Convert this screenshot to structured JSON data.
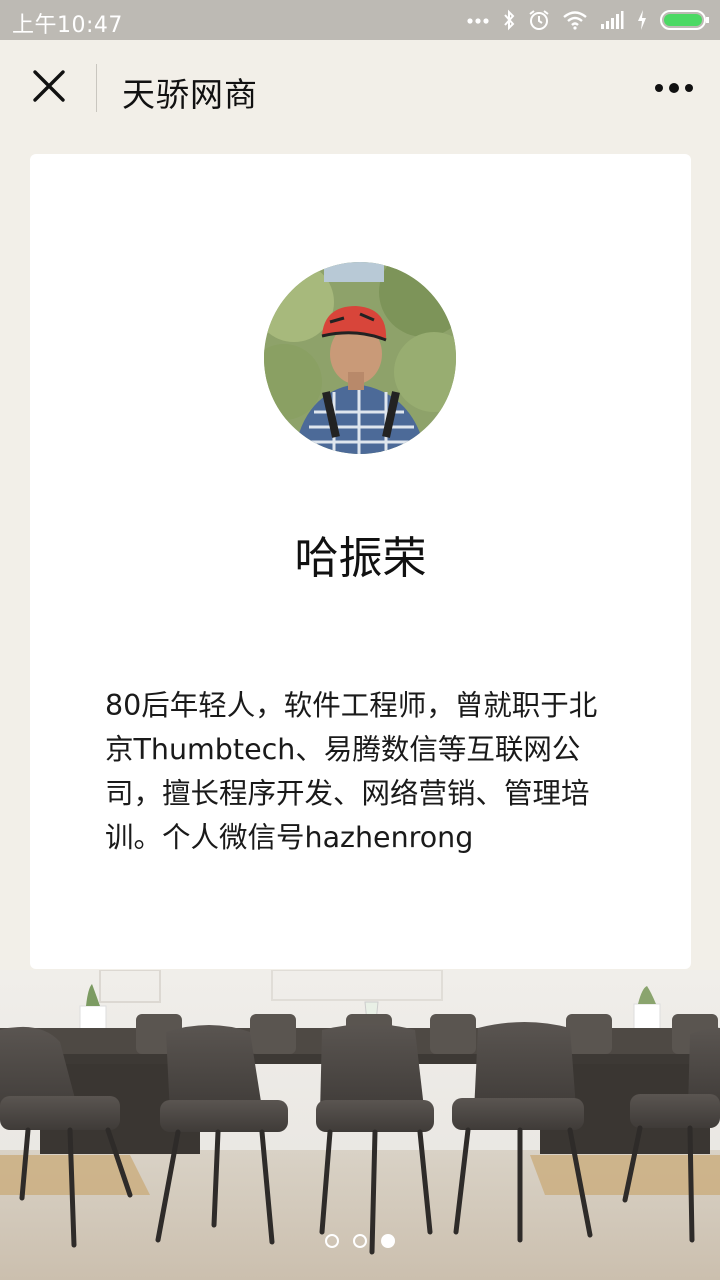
{
  "status_bar": {
    "time": "上午10:47",
    "icons": [
      "more-dots-icon",
      "bluetooth-icon",
      "alarm-icon",
      "wifi-icon",
      "signal-icon",
      "charging-icon",
      "battery-icon"
    ]
  },
  "navbar": {
    "title": "天骄网商",
    "close_icon": "close-icon",
    "more_icon": "more-icon"
  },
  "profile": {
    "name": "哈振荣",
    "bio": "80后年轻人，软件工程师，曾就职于北京Thumbtech、易腾数信等互联网公司，擅长程序开发、网络营销、管理培训。个人微信号hazhenrong"
  },
  "pagination": {
    "total": 3,
    "active": 3
  },
  "colors": {
    "background": "#f2efe8",
    "status_bar": "#bdbab4",
    "battery_green": "#4cd964",
    "card": "#ffffff"
  }
}
